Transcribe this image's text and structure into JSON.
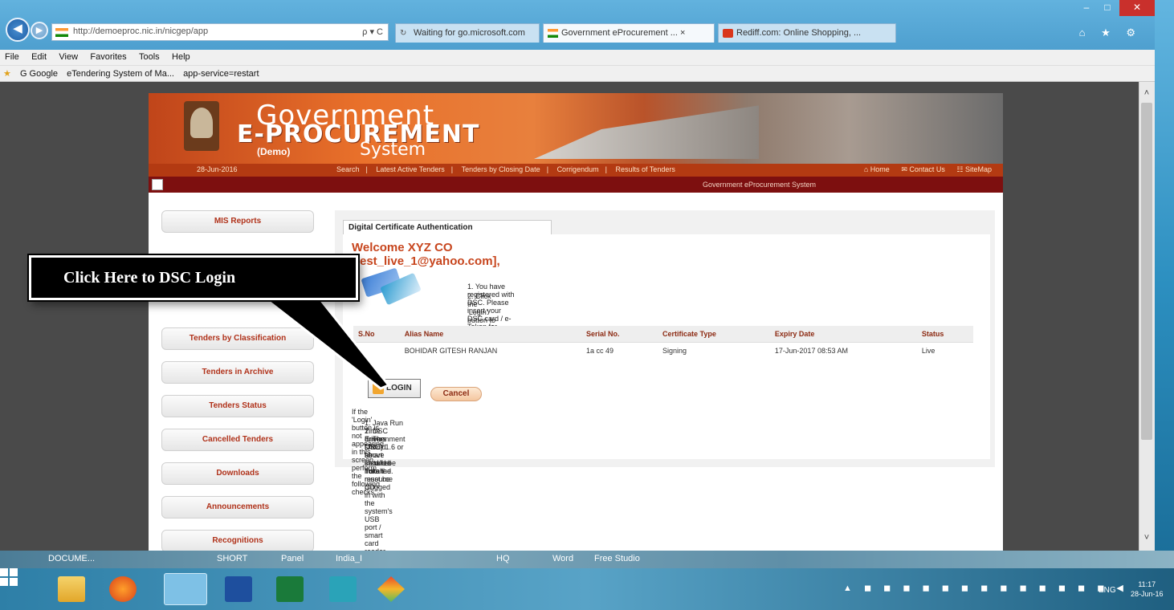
{
  "browser": {
    "url": "http://demoeproc.nic.in/nicgep/app",
    "address_tools": "ρ ▾ C",
    "tabs": [
      {
        "label": "Waiting for go.microsoft.com"
      },
      {
        "label": "Government eProcurement ...  ×"
      },
      {
        "label": "Rediff.com: Online Shopping, ..."
      }
    ],
    "menu": [
      "File",
      "Edit",
      "View",
      "Favorites",
      "Tools",
      "Help"
    ],
    "favorites": [
      "G Google",
      "eTendering System of Ma...",
      "app-service=restart"
    ],
    "window_controls": {
      "minimize": "–",
      "maximize": "□",
      "close": "✕"
    },
    "toolbar_icons": "⌂ ★ ⚙"
  },
  "site": {
    "brand": {
      "line1": "Government",
      "line2": "E-PROCUREMENT",
      "demo": "(Demo)",
      "line3": "System"
    },
    "date": "28-Jun-2016",
    "topnav": [
      "Search",
      "|",
      "Latest Active Tenders",
      "|",
      "Tenders by Closing Date",
      "|",
      "Corrigendum",
      "|",
      "Results of Tenders"
    ],
    "toplinks": [
      "⌂ Home",
      "✉ Contact Us",
      "☷ SiteMap"
    ],
    "system_name": "Government eProcurement System",
    "sidebar": [
      "MIS Reports",
      "Tenders by Classification",
      "Tenders in Archive",
      "Tenders Status",
      "Cancelled Tenders",
      "Downloads",
      "Announcements",
      "Recognitions"
    ]
  },
  "auth": {
    "tab_label": "Digital Certificate Authentication",
    "welcome": "Welcome XYZ CO [test_live_1@yahoo.com],",
    "instructions": [
      "1.  You have registered with DSC. Please insert your DSC card / e-Token for authentication.",
      "2.  Click the 'Login' button to proceed."
    ],
    "table": {
      "headers": [
        "S.No",
        "Alias Name",
        "Serial No.",
        "Certificate Type",
        "Expiry Date",
        "Status"
      ],
      "rows": [
        [
          "",
          "BOHIDAR GITESH RANJAN",
          "1a cc 49",
          "Signing",
          "17-Jun-2017 08:53 AM",
          "Live"
        ]
      ]
    },
    "login_label": "LOGIN",
    "cancel_label": "Cancel",
    "notice_title": "If the 'Login' button is not appearing in this screen, perform the following checks:",
    "notices": [
      "1.  Java Run Time Environment (JRE) 1.6 or above should be installed.",
      "2.  DSC drivers should be installed from the resource CD.",
      "3.  The DSC smart card / e-Token must be plugged in with the system's USB port / smart card reader."
    ]
  },
  "callout": {
    "text": "Click Here to DSC Login"
  },
  "taskbar": {
    "strip_items": [
      "DOCUME...",
      "SHORT",
      "Panel",
      "India_I",
      "HQ",
      "Word",
      "Free Studio"
    ],
    "tray": "▲ ◼ ◼ ◼ ◼ ◼ ◼ ◼ ◼ ◼ ◼ ◼ ◼ ◼ ◀",
    "language": "ENG",
    "time": "11:17",
    "date": "28-Jun-16"
  },
  "colors": {
    "accent": "#c7451d",
    "banner_red": "#b33a12",
    "dark_red": "#7d0f0f"
  }
}
